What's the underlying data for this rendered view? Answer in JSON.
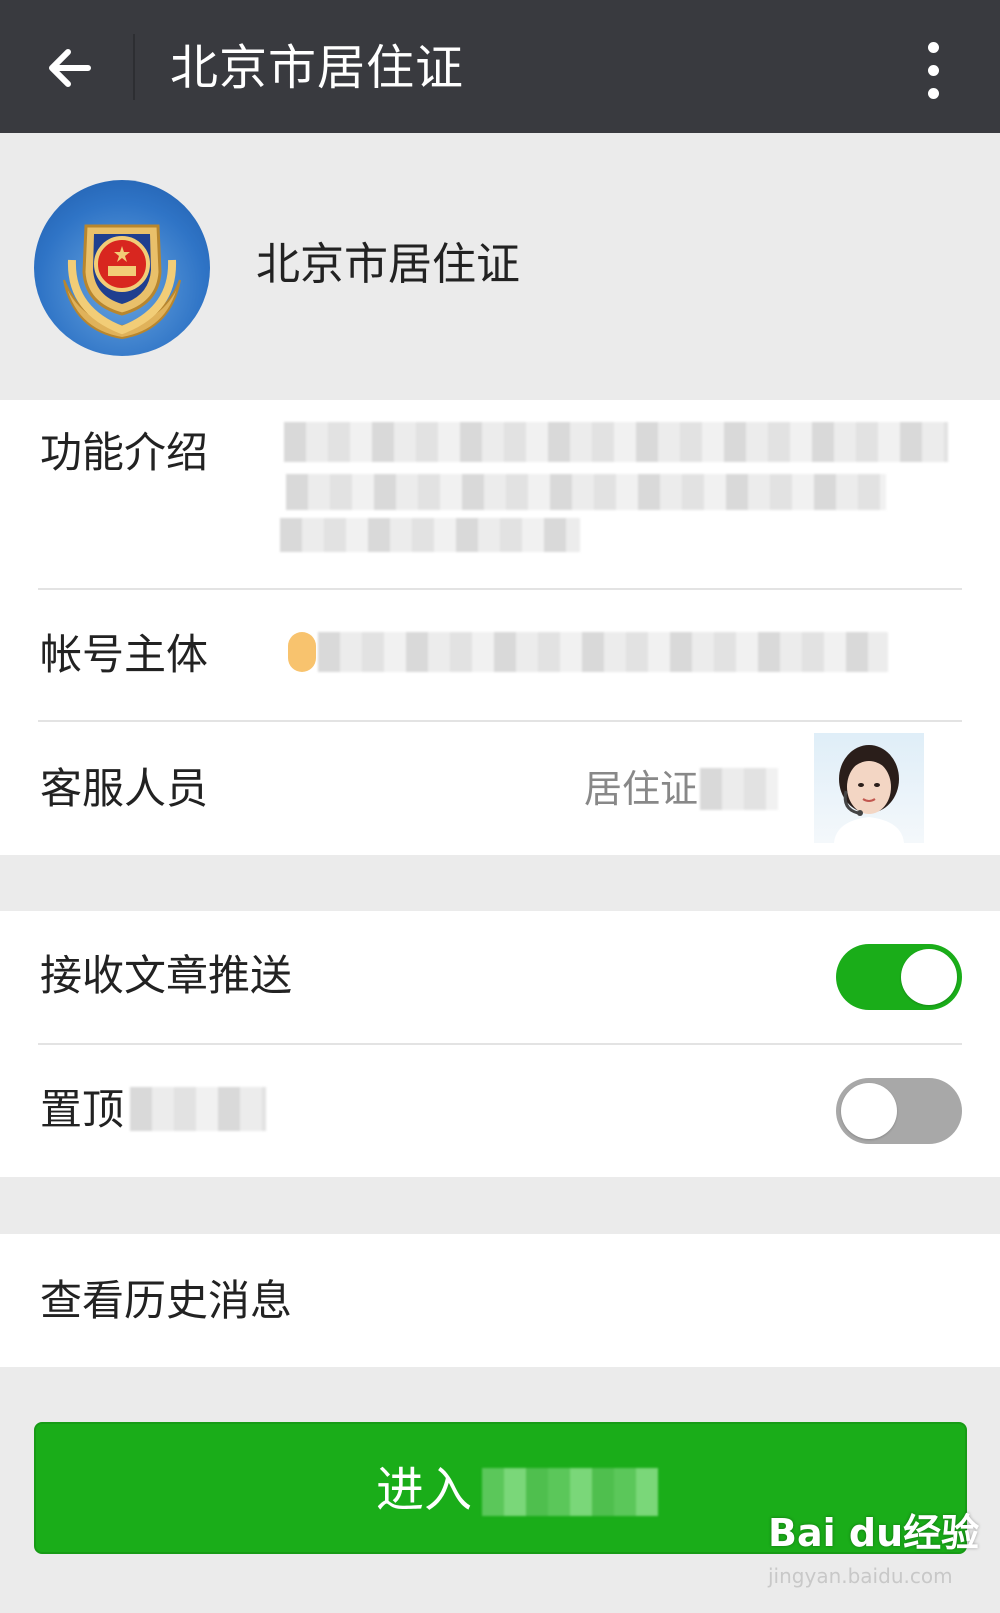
{
  "header": {
    "title": "北京市居住证",
    "back_icon": "arrow-left-icon",
    "more_icon": "more-vertical-icon"
  },
  "profile": {
    "name": "北京市居住证",
    "avatar_icon": "police-emblem"
  },
  "info": {
    "intro_label": "功能介绍",
    "owner_label": "帐号主体",
    "service_label": "客服人员",
    "service_value": "居住证"
  },
  "settings": {
    "push_label": "接收文章推送",
    "push_on": true,
    "pin_label": "置顶",
    "pin_on": false
  },
  "history": {
    "label": "查看历史消息"
  },
  "enter_button": {
    "label": "进入"
  },
  "watermark": {
    "logo": "Bai du经验",
    "url": "jingyan.baidu.com"
  },
  "colors": {
    "topbar": "#393a3f",
    "accent_green": "#1aad19",
    "background": "#ebebeb"
  }
}
